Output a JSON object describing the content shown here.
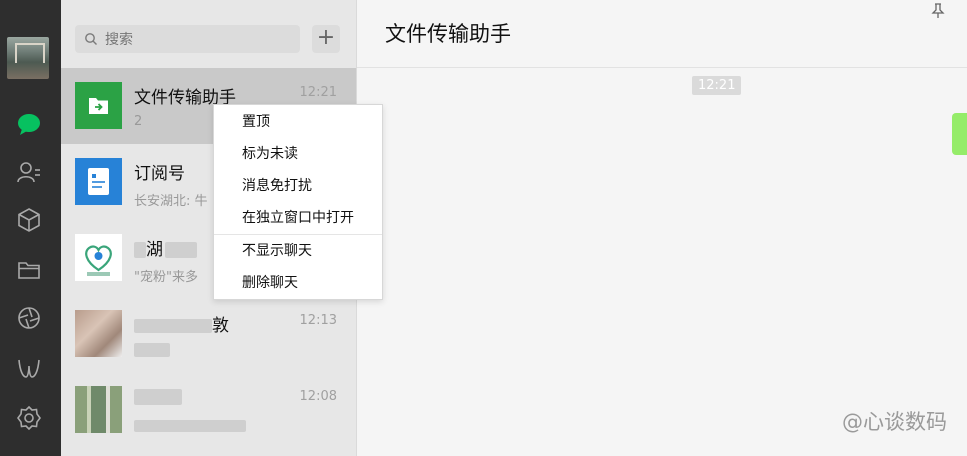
{
  "search": {
    "placeholder": "搜索"
  },
  "add_button": {
    "label": "+"
  },
  "chats": [
    {
      "name": "文件传输助手",
      "time": "12:21",
      "preview": "2"
    },
    {
      "name": "订阅号",
      "time": "",
      "preview": "长安湖北: 牛"
    },
    {
      "name": "湖",
      "time": "",
      "preview": "\"宠粉\"来多"
    },
    {
      "name": "敦",
      "time": "12:13",
      "preview": ""
    },
    {
      "name": "",
      "time": "12:08",
      "preview": ""
    }
  ],
  "chat_window": {
    "title": "文件传输助手",
    "timestamp": "12:21"
  },
  "context_menu": {
    "items": [
      "置顶",
      "标为未读",
      "消息免打扰",
      "在独立窗口中打开",
      "不显示聊天",
      "删除聊天"
    ]
  },
  "watermark": "@心谈数码",
  "colors": {
    "wechat_green": "#07c160",
    "file_icon_green": "#2ba245",
    "subscription_blue": "#2782d7",
    "bubble_green": "#95ec69"
  },
  "icons": [
    "chat-icon",
    "contacts-icon",
    "favorites-icon",
    "folder-icon",
    "moments-icon",
    "mini-programs-icon",
    "settings-icon",
    "search-icon",
    "pin-icon"
  ]
}
